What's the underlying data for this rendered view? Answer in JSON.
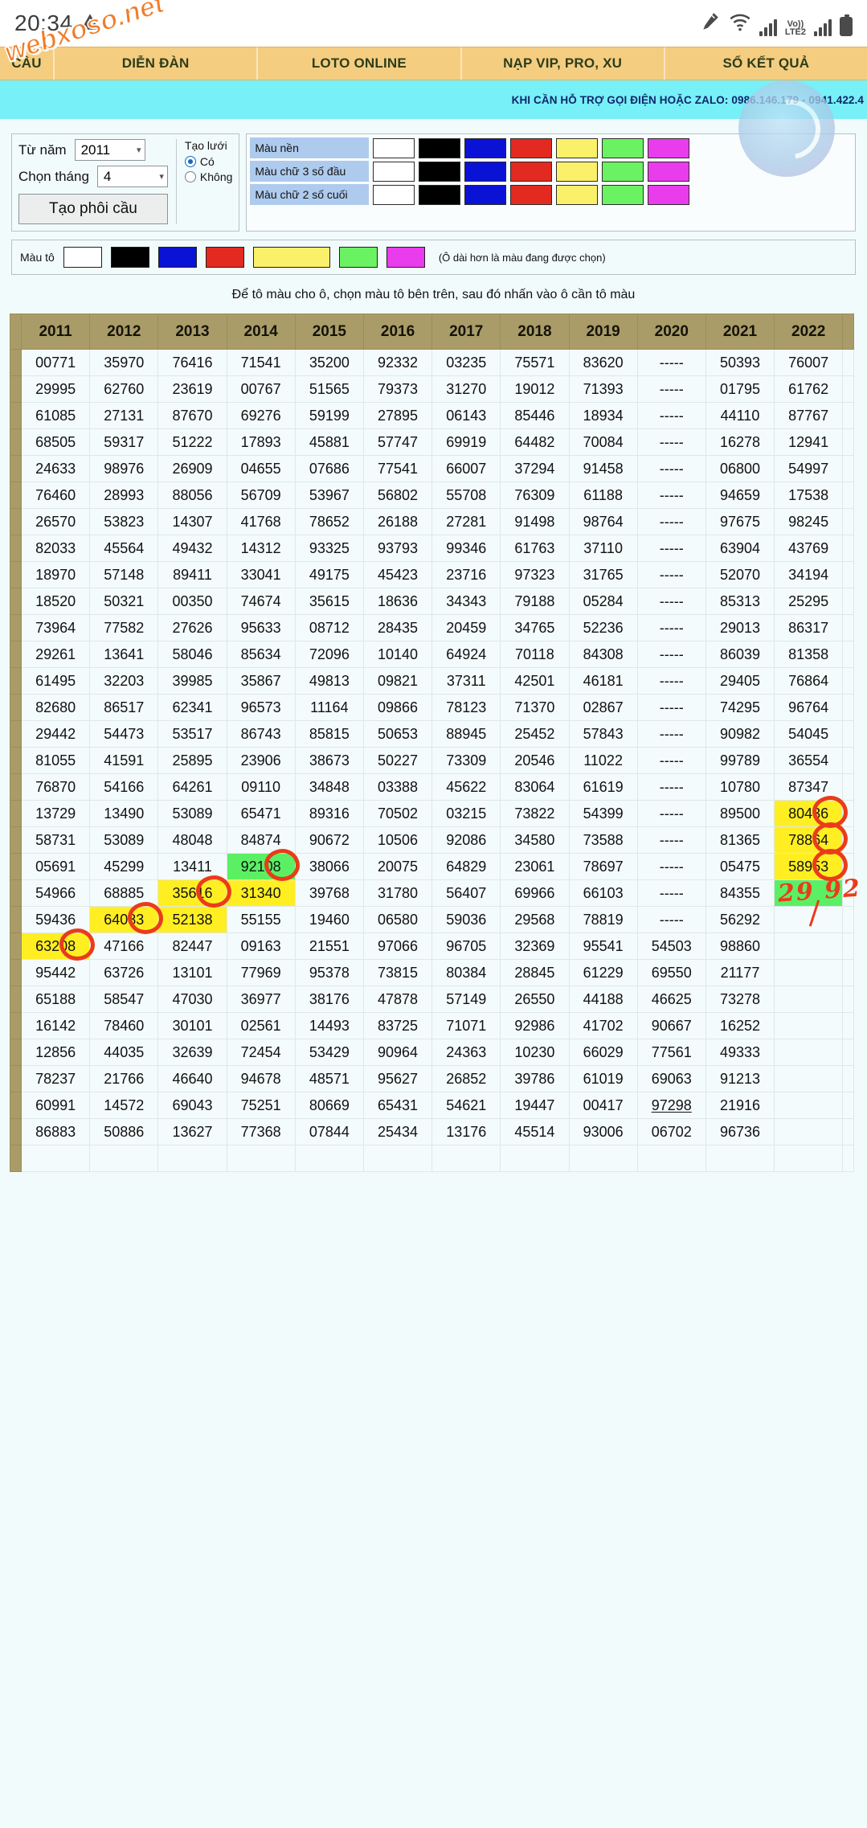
{
  "status_bar": {
    "time": "20:34",
    "icons": [
      "warning-triangle-icon",
      "pen-icon",
      "wifi-icon",
      "signal-bars-icon",
      "volte-label",
      "signal-bars-2-icon",
      "battery-icon"
    ],
    "volte_top": "Vo))",
    "volte_bottom": "LTE2"
  },
  "watermark": {
    "text": "webxoso.net"
  },
  "nav": {
    "tabs": [
      {
        "label": "CẦU"
      },
      {
        "label": "DIỄN ĐÀN"
      },
      {
        "label": "LOTO ONLINE"
      },
      {
        "label": "NẠP VIP, PRO, XU"
      },
      {
        "label": "SỔ KẾT QUẢ"
      }
    ]
  },
  "hotline": {
    "text": "KHI CẦN HỖ TRỢ GỌI ĐIỆN HOẶC ZALO: 0986.146.179 - 0941.422.4"
  },
  "controls": {
    "from_year_label": "Từ năm",
    "from_year_value": "2011",
    "month_label": "Chọn tháng",
    "month_value": "4",
    "make_button": "Tạo phôi cầu",
    "grid_title": "Tạo lưới",
    "grid_yes": "Có",
    "grid_no": "Không",
    "grid_selected": "Có"
  },
  "color_matrix": {
    "rows": [
      {
        "label": "Màu nền"
      },
      {
        "label": "Màu chữ 3 số đầu"
      },
      {
        "label": "Màu chữ 2 số cuối"
      }
    ],
    "swatches": [
      "#ffffff",
      "#000000",
      "#0a12d6",
      "#e22a20",
      "#fbf06a",
      "#6bf263",
      "#e93ced"
    ]
  },
  "fill_bar": {
    "label": "Màu tô",
    "swatches": [
      "#ffffff",
      "#000000",
      "#0a12d6",
      "#e22a20",
      "#fbf06a",
      "#6bf263",
      "#e93ced"
    ],
    "selected_index": 4,
    "note": "(Ô dài hơn là màu đang được chọn)"
  },
  "hint": "Để tô màu cho ô, chọn màu tô bên trên, sau đó nhấn vào ô cần tô màu",
  "table": {
    "headers": [
      "2011",
      "2012",
      "2013",
      "2014",
      "2015",
      "2016",
      "2017",
      "2018",
      "2019",
      "2020",
      "2021",
      "2022"
    ],
    "rows": [
      [
        "00771",
        "35970",
        "76416",
        "71541",
        "35200",
        "92332",
        "03235",
        "75571",
        "83620",
        "-----",
        "50393",
        "76007"
      ],
      [
        "29995",
        "62760",
        "23619",
        "00767",
        "51565",
        "79373",
        "31270",
        "19012",
        "71393",
        "-----",
        "01795",
        "61762"
      ],
      [
        "61085",
        "27131",
        "87670",
        "69276",
        "59199",
        "27895",
        "06143",
        "85446",
        "18934",
        "-----",
        "44110",
        "87767"
      ],
      [
        "68505",
        "59317",
        "51222",
        "17893",
        "45881",
        "57747",
        "69919",
        "64482",
        "70084",
        "-----",
        "16278",
        "12941"
      ],
      [
        "24633",
        "98976",
        "26909",
        "04655",
        "07686",
        "77541",
        "66007",
        "37294",
        "91458",
        "-----",
        "06800",
        "54997"
      ],
      [
        "76460",
        "28993",
        "88056",
        "56709",
        "53967",
        "56802",
        "55708",
        "76309",
        "61188",
        "-----",
        "94659",
        "17538"
      ],
      [
        "26570",
        "53823",
        "14307",
        "41768",
        "78652",
        "26188",
        "27281",
        "91498",
        "98764",
        "-----",
        "97675",
        "98245"
      ],
      [
        "82033",
        "45564",
        "49432",
        "14312",
        "93325",
        "93793",
        "99346",
        "61763",
        "37110",
        "-----",
        "63904",
        "43769"
      ],
      [
        "18970",
        "57148",
        "89411",
        "33041",
        "49175",
        "45423",
        "23716",
        "97323",
        "31765",
        "-----",
        "52070",
        "34194"
      ],
      [
        "18520",
        "50321",
        "00350",
        "74674",
        "35615",
        "18636",
        "34343",
        "79188",
        "05284",
        "-----",
        "85313",
        "25295"
      ],
      [
        "73964",
        "77582",
        "27626",
        "95633",
        "08712",
        "28435",
        "20459",
        "34765",
        "52236",
        "-----",
        "29013",
        "86317"
      ],
      [
        "29261",
        "13641",
        "58046",
        "85634",
        "72096",
        "10140",
        "64924",
        "70118",
        "84308",
        "-----",
        "86039",
        "81358"
      ],
      [
        "61495",
        "32203",
        "39985",
        "35867",
        "49813",
        "09821",
        "37311",
        "42501",
        "46181",
        "-----",
        "29405",
        "76864"
      ],
      [
        "82680",
        "86517",
        "62341",
        "96573",
        "11164",
        "09866",
        "78123",
        "71370",
        "02867",
        "-----",
        "74295",
        "96764"
      ],
      [
        "29442",
        "54473",
        "53517",
        "86743",
        "85815",
        "50653",
        "88945",
        "25452",
        "57843",
        "-----",
        "90982",
        "54045"
      ],
      [
        "81055",
        "41591",
        "25895",
        "23906",
        "38673",
        "50227",
        "73309",
        "20546",
        "11022",
        "-----",
        "99789",
        "36554"
      ],
      [
        "76870",
        "54166",
        "64261",
        "09110",
        "34848",
        "03388",
        "45622",
        "83064",
        "61619",
        "-----",
        "10780",
        "87347"
      ],
      [
        "13729",
        "13490",
        "53089",
        "65471",
        "89316",
        "70502",
        "03215",
        "73822",
        "54399",
        "-----",
        "89500",
        "80436"
      ],
      [
        "58731",
        "53089",
        "48048",
        "84874",
        "90672",
        "10506",
        "92086",
        "34580",
        "73588",
        "-----",
        "81365",
        "78864"
      ],
      [
        "05691",
        "45299",
        "13411",
        "92108",
        "38066",
        "20075",
        "64829",
        "23061",
        "78697",
        "-----",
        "05475",
        "58953"
      ],
      [
        "54966",
        "68885",
        "35616",
        "31340",
        "39768",
        "31780",
        "56407",
        "69966",
        "66103",
        "-----",
        "84355",
        ""
      ],
      [
        "59436",
        "64083",
        "52138",
        "55155",
        "19460",
        "06580",
        "59036",
        "29568",
        "78819",
        "-----",
        "56292",
        ""
      ],
      [
        "63208",
        "47166",
        "82447",
        "09163",
        "21551",
        "97066",
        "96705",
        "32369",
        "95541",
        "54503",
        "98860",
        ""
      ],
      [
        "95442",
        "63726",
        "13101",
        "77969",
        "95378",
        "73815",
        "80384",
        "28845",
        "61229",
        "69550",
        "21177",
        ""
      ],
      [
        "65188",
        "58547",
        "47030",
        "36977",
        "38176",
        "47878",
        "57149",
        "26550",
        "44188",
        "46625",
        "73278",
        ""
      ],
      [
        "16142",
        "78460",
        "30101",
        "02561",
        "14493",
        "83725",
        "71071",
        "92986",
        "41702",
        "90667",
        "16252",
        ""
      ],
      [
        "12856",
        "44035",
        "32639",
        "72454",
        "53429",
        "90964",
        "24363",
        "10230",
        "66029",
        "77561",
        "49333",
        ""
      ],
      [
        "78237",
        "21766",
        "46640",
        "94678",
        "48571",
        "95627",
        "26852",
        "39786",
        "61019",
        "69063",
        "91213",
        ""
      ],
      [
        "60991",
        "14572",
        "69043",
        "75251",
        "80669",
        "65431",
        "54621",
        "19447",
        "00417",
        "97298",
        "21916",
        ""
      ],
      [
        "86883",
        "50886",
        "13627",
        "77368",
        "07844",
        "25434",
        "13176",
        "45514",
        "93006",
        "06702",
        "96736",
        ""
      ],
      [
        "",
        "",
        "",
        "",
        "",
        "",
        "",
        "",
        "",
        "",
        "",
        ""
      ]
    ],
    "highlights": [
      {
        "row": 17,
        "col": 11,
        "fill": "yellow"
      },
      {
        "row": 18,
        "col": 11,
        "fill": "yellow"
      },
      {
        "row": 19,
        "col": 11,
        "fill": "yellow"
      },
      {
        "row": 19,
        "col": 3,
        "fill": "green"
      },
      {
        "row": 20,
        "col": 11,
        "fill": "green"
      },
      {
        "row": 20,
        "col": 2,
        "fill": "yellow"
      },
      {
        "row": 20,
        "col": 3,
        "fill": "yellow"
      },
      {
        "row": 21,
        "col": 1,
        "fill": "yellow"
      },
      {
        "row": 21,
        "col": 2,
        "fill": "yellow"
      },
      {
        "row": 22,
        "col": 0,
        "fill": "yellow"
      }
    ],
    "underlined": [
      {
        "row": 28,
        "col": 9
      }
    ],
    "annotations": {
      "circles": [
        {
          "row": 17,
          "col": 11,
          "label": "circle-80436"
        },
        {
          "row": 18,
          "col": 11,
          "label": "circle-78864"
        },
        {
          "row": 19,
          "col": 11,
          "label": "circle-58953"
        },
        {
          "row": 19,
          "col": 3,
          "label": "circle-92108"
        },
        {
          "row": 20,
          "col": 2,
          "label": "circle-35616"
        },
        {
          "row": 21,
          "col": 1,
          "label": "circle-64083"
        },
        {
          "row": 22,
          "col": 0,
          "label": "circle-63208"
        }
      ],
      "handwritten": [
        {
          "row": 20,
          "col": 11,
          "text": "29 92"
        }
      ]
    }
  }
}
